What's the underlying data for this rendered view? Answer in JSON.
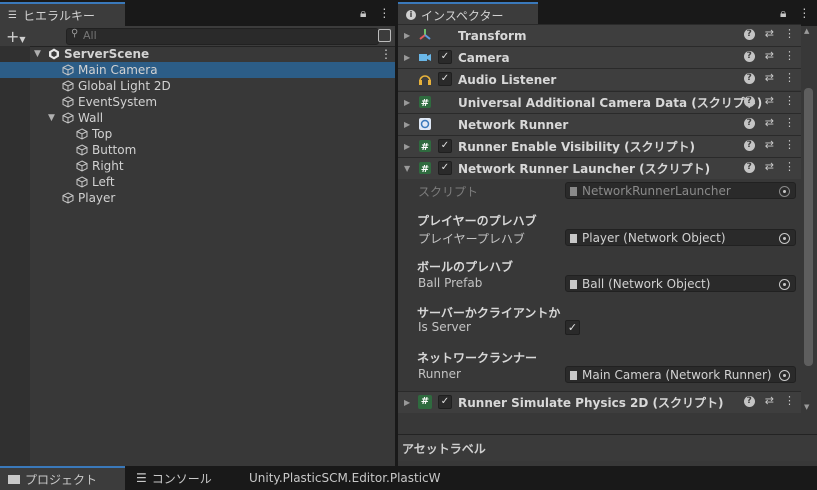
{
  "hierarchy": {
    "tab_label": "ヒエラルキー",
    "search_placeholder": "All",
    "add_label": "+",
    "tree": [
      {
        "label": "ServerScene",
        "depth": 0,
        "scene": true
      },
      {
        "label": "Main Camera",
        "depth": 1,
        "selected": true
      },
      {
        "label": "Global Light 2D",
        "depth": 1
      },
      {
        "label": "EventSystem",
        "depth": 1
      },
      {
        "label": "Wall",
        "depth": 1,
        "expanded": true
      },
      {
        "label": "Top",
        "depth": 2
      },
      {
        "label": "Buttom",
        "depth": 2
      },
      {
        "label": "Right",
        "depth": 2
      },
      {
        "label": "Left",
        "depth": 2
      },
      {
        "label": "Player",
        "depth": 1
      }
    ]
  },
  "inspector": {
    "tab_label": "インスペクター",
    "components": [
      {
        "name": "Transform",
        "icon": "transform-icon"
      },
      {
        "name": "Camera",
        "icon": "camera-icon",
        "checked": true
      },
      {
        "name": "Audio Listener",
        "icon": "headphones-icon",
        "checked": true
      },
      {
        "name": "Universal Additional Camera Data (スクリプト)",
        "icon": "script-icon"
      },
      {
        "name": "Network Runner",
        "icon": "network-icon"
      },
      {
        "name": "Runner Enable Visibility (スクリプト)",
        "icon": "script-icon",
        "checked": true
      },
      {
        "name": "Network Runner Launcher (スクリプト)",
        "icon": "script-icon",
        "checked": true,
        "expanded": true
      }
    ],
    "script_label": "スクリプト",
    "script_value": "NetworkRunnerLauncher",
    "sections": [
      {
        "header": "プレイヤーのプレハブ",
        "label": "プレイヤープレハブ",
        "value": "Player (Network Object)"
      },
      {
        "header": "ボールのプレハブ",
        "label": "Ball Prefab",
        "value": "Ball (Network Object)"
      },
      {
        "header": "サーバーかクライアントか",
        "label": "Is Server",
        "check": "✓"
      },
      {
        "header": "ネットワークランナー",
        "label": "Runner",
        "value": "Main Camera (Network Runner)"
      }
    ],
    "last_component": "Runner Simulate Physics 2D (スクリプト)",
    "asset_label": "アセットラベル"
  },
  "bottom": {
    "project_tab": "プロジェクト",
    "console_tab": "コンソール",
    "plastic_tab": "Unity.PlasticSCM.Editor.PlasticW"
  },
  "colors": {
    "selection": "#2c5d87",
    "tab_accent": "#3a79bb"
  }
}
